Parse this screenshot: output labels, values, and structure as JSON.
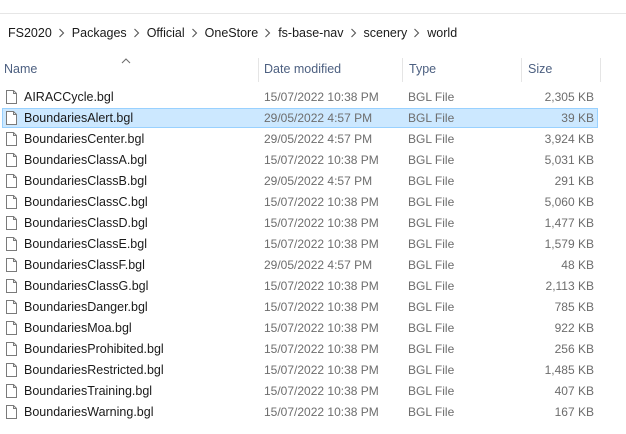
{
  "breadcrumb": [
    "FS2020",
    "Packages",
    "Official",
    "OneStore",
    "fs-base-nav",
    "scenery",
    "world"
  ],
  "columns": {
    "name": "Name",
    "date": "Date modified",
    "type": "Type",
    "size": "Size"
  },
  "files": [
    {
      "name": "AIRACCycle.bgl",
      "date": "15/07/2022 10:38 PM",
      "type": "BGL File",
      "size": "2,305 KB",
      "selected": false
    },
    {
      "name": "BoundariesAlert.bgl",
      "date": "29/05/2022 4:57 PM",
      "type": "BGL File",
      "size": "39 KB",
      "selected": true
    },
    {
      "name": "BoundariesCenter.bgl",
      "date": "29/05/2022 4:57 PM",
      "type": "BGL File",
      "size": "3,924 KB",
      "selected": false
    },
    {
      "name": "BoundariesClassA.bgl",
      "date": "15/07/2022 10:38 PM",
      "type": "BGL File",
      "size": "5,031 KB",
      "selected": false
    },
    {
      "name": "BoundariesClassB.bgl",
      "date": "29/05/2022 4:57 PM",
      "type": "BGL File",
      "size": "291 KB",
      "selected": false
    },
    {
      "name": "BoundariesClassC.bgl",
      "date": "15/07/2022 10:38 PM",
      "type": "BGL File",
      "size": "5,060 KB",
      "selected": false
    },
    {
      "name": "BoundariesClassD.bgl",
      "date": "15/07/2022 10:38 PM",
      "type": "BGL File",
      "size": "1,477 KB",
      "selected": false
    },
    {
      "name": "BoundariesClassE.bgl",
      "date": "15/07/2022 10:38 PM",
      "type": "BGL File",
      "size": "1,579 KB",
      "selected": false
    },
    {
      "name": "BoundariesClassF.bgl",
      "date": "29/05/2022 4:57 PM",
      "type": "BGL File",
      "size": "48 KB",
      "selected": false
    },
    {
      "name": "BoundariesClassG.bgl",
      "date": "15/07/2022 10:38 PM",
      "type": "BGL File",
      "size": "2,113 KB",
      "selected": false
    },
    {
      "name": "BoundariesDanger.bgl",
      "date": "15/07/2022 10:38 PM",
      "type": "BGL File",
      "size": "785 KB",
      "selected": false
    },
    {
      "name": "BoundariesMoa.bgl",
      "date": "15/07/2022 10:38 PM",
      "type": "BGL File",
      "size": "922 KB",
      "selected": false
    },
    {
      "name": "BoundariesProhibited.bgl",
      "date": "15/07/2022 10:38 PM",
      "type": "BGL File",
      "size": "256 KB",
      "selected": false
    },
    {
      "name": "BoundariesRestricted.bgl",
      "date": "15/07/2022 10:38 PM",
      "type": "BGL File",
      "size": "1,485 KB",
      "selected": false
    },
    {
      "name": "BoundariesTraining.bgl",
      "date": "15/07/2022 10:38 PM",
      "type": "BGL File",
      "size": "407 KB",
      "selected": false
    },
    {
      "name": "BoundariesWarning.bgl",
      "date": "15/07/2022 10:38 PM",
      "type": "BGL File",
      "size": "167 KB",
      "selected": false
    }
  ],
  "icons": {
    "file": "file-icon",
    "separator": "chevron-right-icon",
    "sort": "sort-up-icon"
  },
  "colors": {
    "selection_bg": "#cce8ff",
    "selection_border": "#99d1ff",
    "header_text": "#4d6081"
  }
}
